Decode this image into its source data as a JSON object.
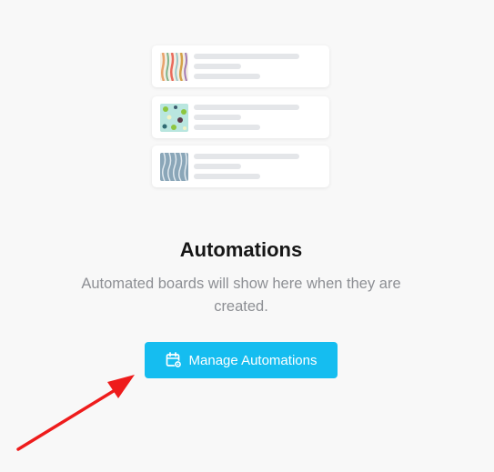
{
  "empty_state": {
    "title": "Automations",
    "description": "Automated boards will show here when they are created.",
    "button_label": "Manage Automations",
    "button_icon": "calendar-gear-icon"
  },
  "illustration": {
    "cards": [
      {
        "thumb_style": "colored-vertical-stripes"
      },
      {
        "thumb_style": "dotted-mint-pattern"
      },
      {
        "thumb_style": "blue-vertical-waves"
      }
    ]
  },
  "colors": {
    "button": "#15bdf0",
    "annotation_arrow": "#ee1c1c"
  }
}
